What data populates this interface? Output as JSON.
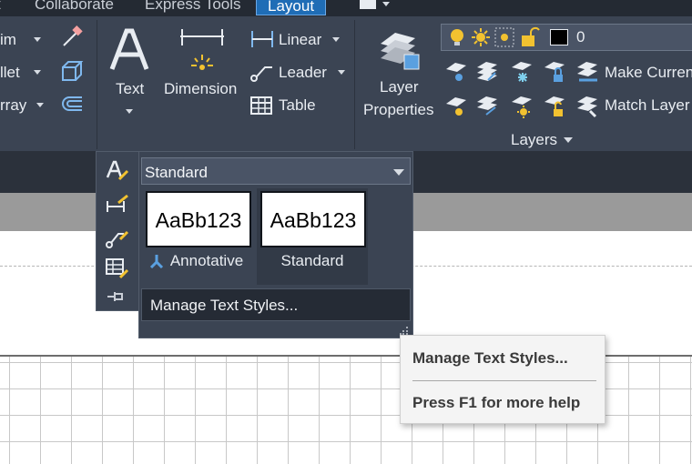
{
  "tabs": [
    "t",
    "Collaborate",
    "Express Tools",
    "Layout"
  ],
  "ribbon": {
    "annotation": {
      "left_items": [
        "im",
        "llet",
        "rray"
      ],
      "text_label": "Text",
      "dimension_label": "Dimension",
      "linear_label": "Linear",
      "leader_label": "Leader",
      "table_label": "Table"
    },
    "layers": {
      "layer_properties": [
        "Layer",
        "Properties"
      ],
      "current_layer": "0",
      "make_current_label": "Make Current",
      "match_layer_label": "Match Layer",
      "panel_title": "Layers"
    }
  },
  "text_style_dropdown": {
    "selected_style": "Standard",
    "gallery": [
      {
        "name": "Annotative",
        "preview": "AaBb123",
        "annotative": true
      },
      {
        "name": "Standard",
        "preview": "AaBb123",
        "selected": true
      }
    ],
    "manage_label": "Manage Text Styles..."
  },
  "tooltip": {
    "title": "Manage Text Styles...",
    "help": "Press F1 for more help"
  },
  "colors": {
    "ribbon_bg": "#3b4453",
    "tab_active": "#1f6db6",
    "tooltip_bg": "#f4f4f4",
    "layer_bulb": "#f2c230"
  }
}
